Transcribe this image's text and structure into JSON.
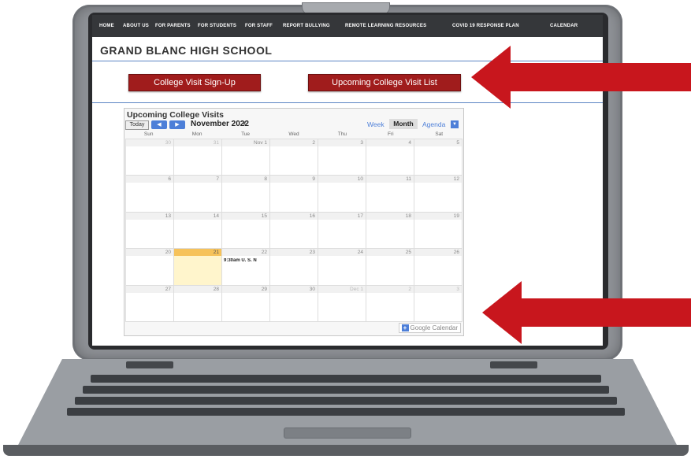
{
  "nav": [
    "HOME",
    "ABOUT US",
    "FOR PARENTS",
    "FOR STUDENTS",
    "FOR STAFF",
    "REPORT BULLYING",
    "REMOTE LEARNING RESOURCES",
    "COVID 19 RESPONSE PLAN",
    "CALENDAR"
  ],
  "school_title": "GRAND BLANC HIGH SCHOOL",
  "buttons": {
    "signup": "College Visit Sign-Up",
    "list": "Upcoming College Visit List"
  },
  "calendar": {
    "title": "Upcoming College Visits",
    "today_label": "Today",
    "prev_icon": "chevron-left-icon",
    "next_icon": "chevron-right-icon",
    "month_label": "November 2022",
    "views": {
      "week": "Week",
      "month": "Month",
      "agenda": "Agenda"
    },
    "days_of_week": [
      "Sun",
      "Mon",
      "Tue",
      "Wed",
      "Thu",
      "Fri",
      "Sat"
    ],
    "weeks": [
      [
        "30",
        "31",
        "Nov 1",
        "2",
        "3",
        "4",
        "5"
      ],
      [
        "6",
        "7",
        "8",
        "9",
        "10",
        "11",
        "12"
      ],
      [
        "13",
        "14",
        "15",
        "16",
        "17",
        "18",
        "19"
      ],
      [
        "20",
        "21",
        "22",
        "23",
        "24",
        "25",
        "26"
      ],
      [
        "27",
        "28",
        "29",
        "30",
        "Dec 1",
        "2",
        "3"
      ]
    ],
    "event_text": "9:30am U. S. N",
    "footer": "Google Calendar",
    "colors": {
      "accent": "#4d7fd8",
      "today": "#f6c25a"
    }
  },
  "colors": {
    "nav_bg": "#35373a",
    "button_red": "#a01c1c",
    "arrow_red": "#c8161d"
  }
}
